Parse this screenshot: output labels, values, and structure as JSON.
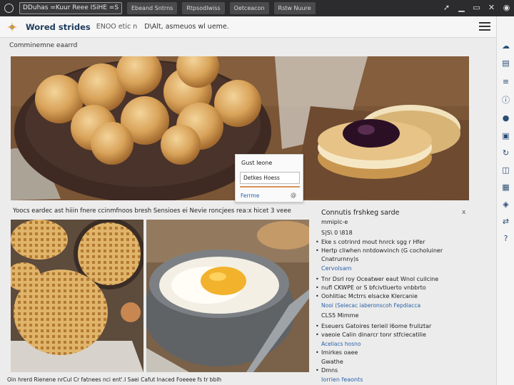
{
  "topbar": {
    "url": "DDuhas =Kuur Reee ISiHE =S",
    "tabs": [
      "Ebeand Sntrns",
      "Rtpsodlwiss",
      "Oetceacon",
      "Rstw Nuure"
    ],
    "controls": [
      "arrow-icon",
      "minimize-icon",
      "window-icon",
      "close-icon",
      "user-icon"
    ]
  },
  "appbar": {
    "title": "Wored strides",
    "subtitle": "ENOO etic n",
    "note": "D\\Alt, asmeuos wl ueme."
  },
  "section_label": "Comminemne eaarrd",
  "hero_caption": "Yoocs eardec ast hiiin fnere ccinmfnoos bresh Sensioes ei Nevie roncjees rea:x hicet 3 veee",
  "bottom_caption": "Oin hrerd Rienene nrCul Cr fatnees nci ent'.I Saei Cafut lnaced Foeeee fs tr bblh",
  "popup": {
    "title": "Gust Ieone",
    "field": "Detkes Hoess",
    "link": "Ferrme",
    "icon": "at-icon"
  },
  "panel": {
    "title": "Connutis frshkeg sarde",
    "close": "x",
    "lines": [
      {
        "text": "mmiplc-e",
        "style": "plain"
      },
      {
        "text": "S|S\\ 0 \\818",
        "style": "plain"
      },
      {
        "text": "Eke s cotrinrd mout hnrck sgg r Hfer",
        "style": "bullet"
      },
      {
        "text": "Hertp cliwhen nntdowvinch (G cocholuiner",
        "style": "bullet"
      },
      {
        "text": "Cnatrurnny)s",
        "style": "plain"
      },
      {
        "text": "Cervolsam",
        "style": "link"
      },
      {
        "text": "Tnr Dsrl roy Oceatwer eaut Wnol cuilcine",
        "style": "bullet"
      },
      {
        "text": "nufl CKWPE or S bfcivtluerto vnbbrto",
        "style": "bullet"
      },
      {
        "text": "Oohlitiac Mctrrs elsacke Klercanie",
        "style": "bullet"
      },
      {
        "text": "Nooi (Seiecac iaberonscoh Fepdiacca",
        "style": "link-small"
      },
      {
        "text": "CLS5 Mimme",
        "style": "plain"
      },
      {
        "text": "Eseuers Gatoires terieil l6ome fruliztar",
        "style": "bullet"
      },
      {
        "text": "vaeoie Calin dinarcr tonr stfciecatilie",
        "style": "bullet"
      },
      {
        "text": "Aceliacs hosno",
        "style": "link-small"
      },
      {
        "text": "Imirkes oaee",
        "style": "bullet"
      },
      {
        "text": "Gwathe",
        "style": "plain"
      },
      {
        "text": "Dmns",
        "style": "bullet"
      },
      {
        "text": "Iorrien feaonts",
        "style": "link"
      }
    ]
  },
  "rail_icons": [
    "cloud-icon",
    "document-icon",
    "layers-icon",
    "info-icon",
    "globe-icon",
    "chat-icon",
    "refresh-icon",
    "book-icon",
    "grid-icon",
    "tag-icon",
    "sync-icon",
    "help-icon"
  ],
  "colors": {
    "accent": "#2a62a8",
    "topbar": "#2c2c2e",
    "popup_underline": "#d8915a"
  }
}
